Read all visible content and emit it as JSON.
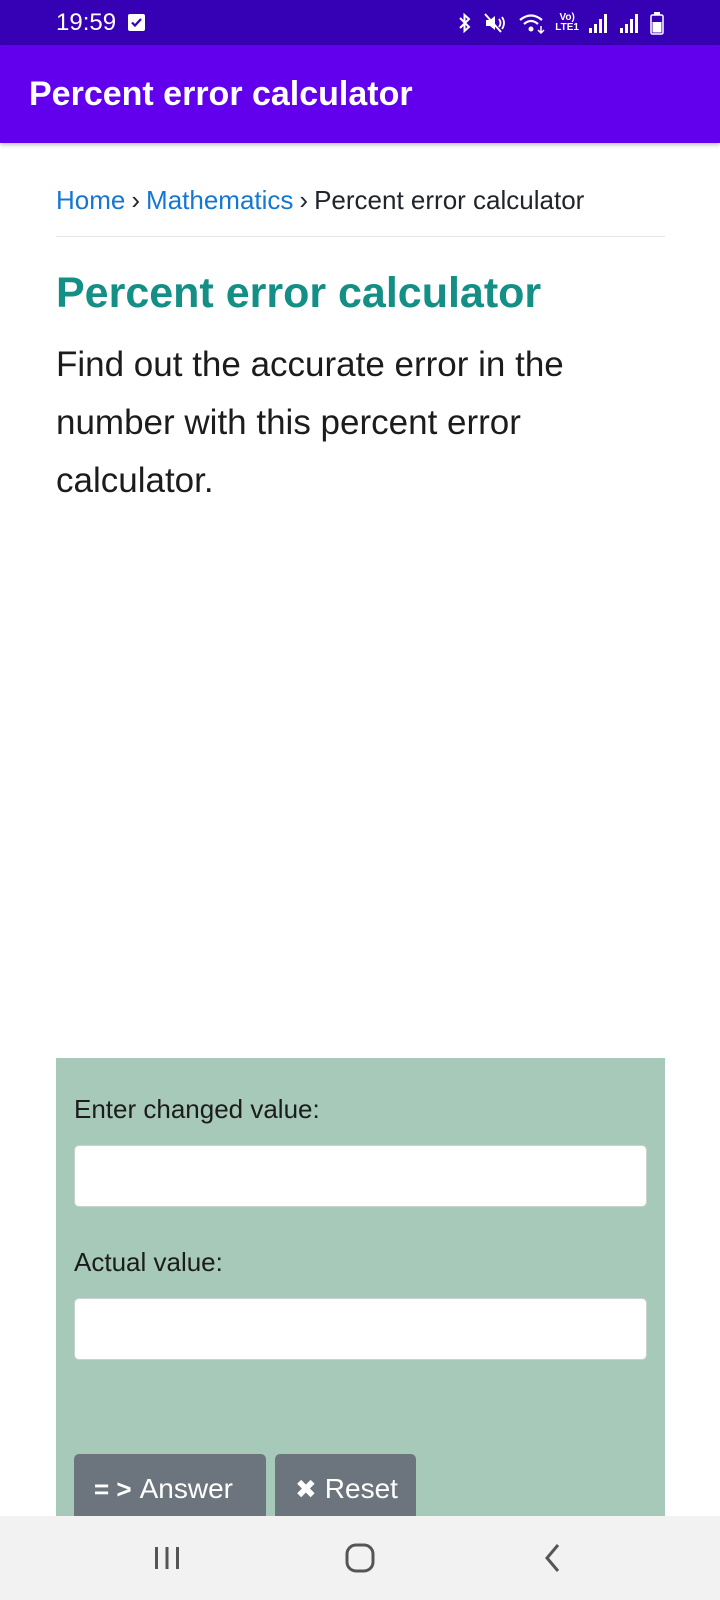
{
  "status_bar": {
    "time": "19:59",
    "network_label_top": "Vo)",
    "network_label_bottom": "LTE1",
    "icons": [
      "check-box-icon",
      "bluetooth-icon",
      "mute-icon",
      "wifi-icon",
      "signal-icon",
      "signal-icon",
      "battery-icon"
    ]
  },
  "app_bar": {
    "title": "Percent error calculator"
  },
  "breadcrumb": {
    "home": "Home",
    "category": "Mathematics",
    "current": "Percent error calculator",
    "separator": "›"
  },
  "page": {
    "title": "Percent error calculator",
    "description": "Find out the accurate error in the number with this percent error calculator."
  },
  "calculator": {
    "changed_label": "Enter changed value:",
    "changed_value": "",
    "actual_label": "Actual value:",
    "actual_value": "",
    "answer_icon": "= >",
    "answer_label": "Answer",
    "reset_icon": "✖",
    "reset_label": "Reset"
  },
  "colors": {
    "status_bar": "#3600b5",
    "app_bar": "#6200ee",
    "link": "#1577d4",
    "title": "#138f86",
    "panel": "#a7c9b9",
    "button": "#6c757d"
  },
  "nav_bar": {
    "icons": [
      "recent-apps-icon",
      "home-icon",
      "back-icon"
    ]
  }
}
